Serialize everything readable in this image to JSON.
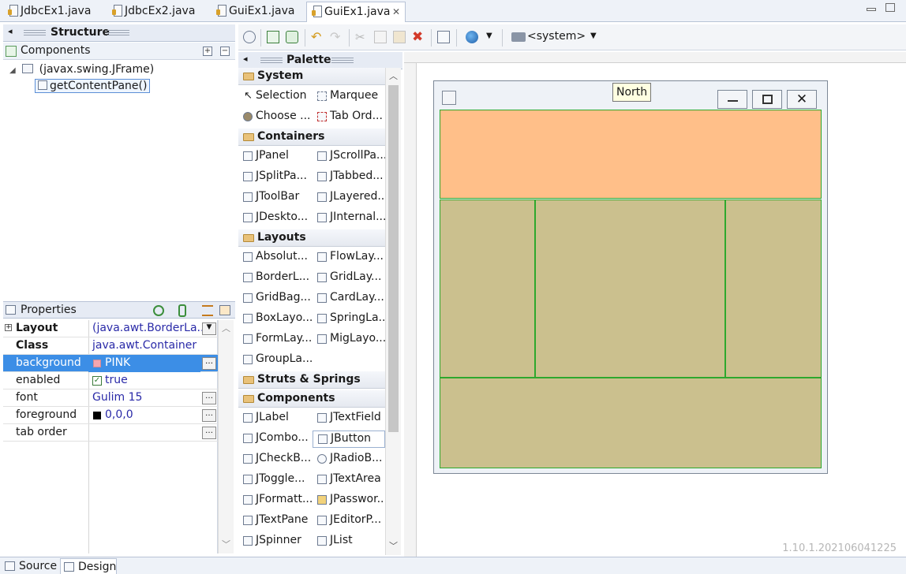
{
  "editor_tabs": [
    {
      "label": "JdbcEx1.java",
      "active": false
    },
    {
      "label": "JdbcEx2.java",
      "active": false
    },
    {
      "label": "GuiEx1.java",
      "active": false
    },
    {
      "label": "GuiEx1.java",
      "active": true
    }
  ],
  "structure": {
    "title": "Structure",
    "components_label": "Components",
    "tree": {
      "root": "(javax.swing.JFrame)",
      "child": "getContentPane()"
    }
  },
  "properties": {
    "title": "Properties",
    "rows": [
      {
        "name": "Layout",
        "value": "(java.awt.BorderLa...",
        "bold": true,
        "expandable": true,
        "control": "dropdown"
      },
      {
        "name": "Class",
        "value": "java.awt.Container",
        "bold": true,
        "control": ""
      },
      {
        "name": "background",
        "value": "PINK",
        "selected": true,
        "swatch": "#f4a6b0",
        "control": "dots"
      },
      {
        "name": "enabled",
        "value": "true",
        "checkbox": true,
        "control": ""
      },
      {
        "name": "font",
        "value": "Gulim 15",
        "control": "dots"
      },
      {
        "name": "foreground",
        "value": "0,0,0",
        "swatch": "#000000",
        "control": "dots"
      },
      {
        "name": "tab order",
        "value": "",
        "control": "dots"
      }
    ]
  },
  "toolbar": {
    "system_label": "<system>"
  },
  "palette": {
    "title": "Palette",
    "categories": [
      {
        "name": "System",
        "items": [
          "Selection",
          "Marquee",
          "Choose ...",
          "Tab Ord..."
        ]
      },
      {
        "name": "Containers",
        "items": [
          "JPanel",
          "JScrollPa...",
          "JSplitPa...",
          "JTabbed...",
          "JToolBar",
          "JLayered...",
          "JDeskto...",
          "JInternal..."
        ]
      },
      {
        "name": "Layouts",
        "items": [
          "Absolut...",
          "FlowLay...",
          "BorderL...",
          "GridLay...",
          "GridBag...",
          "CardLay...",
          "BoxLayo...",
          "SpringLa...",
          "FormLay...",
          "MigLayo...",
          "GroupLa..."
        ]
      },
      {
        "name": "Struts & Springs",
        "items": []
      },
      {
        "name": "Components",
        "items": [
          "JLabel",
          "JTextField",
          "JCombo...",
          "JButton",
          "JCheckB...",
          "JRadioB...",
          "JToggle...",
          "JTextArea",
          "JFormatt...",
          "JPasswor...",
          "JTextPane",
          "JEditorP...",
          "JSpinner",
          "JList"
        ]
      }
    ]
  },
  "design": {
    "tooltip": "North",
    "colors": {
      "north": "#ffbf89",
      "other_regions": "#cbc08e",
      "region_border": "#2ea82e"
    }
  },
  "version": "1.10.1.202106041225",
  "bottom_tabs": [
    {
      "label": "Source",
      "active": false
    },
    {
      "label": "Design",
      "active": true
    }
  ]
}
